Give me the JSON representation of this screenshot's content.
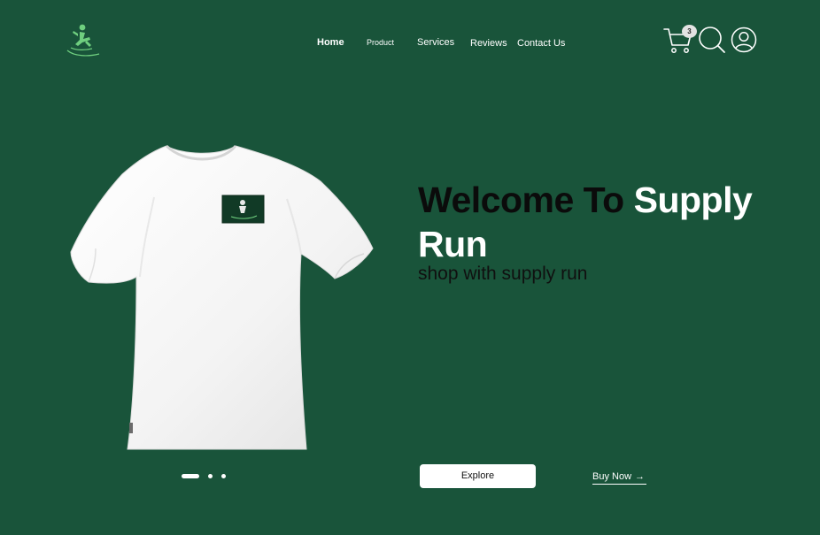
{
  "brand": {
    "logo_icon": "surfer-logo-icon",
    "accent_color": "#6fcf7f"
  },
  "nav": {
    "items": [
      {
        "label": "Home"
      },
      {
        "label": "Product"
      },
      {
        "label": "Services"
      },
      {
        "label": "Reviews"
      },
      {
        "label": "Contact Us"
      }
    ]
  },
  "header_icons": {
    "cart_icon": "cart-icon",
    "cart_count": "3",
    "search_icon": "search-icon",
    "user_icon": "user-icon"
  },
  "hero": {
    "title_dark": "Welcome To",
    "title_light_1": "Supply",
    "title_light_2": "Run",
    "subtitle": "shop with supply run",
    "image": "white-tshirt-image"
  },
  "carousel": {
    "slides": 3,
    "active_index": 0
  },
  "actions": {
    "explore_label": "Explore",
    "buy_now_label": "Buy Now",
    "buy_now_icon": "arrow-right-icon"
  },
  "colors": {
    "background": "#19543a",
    "title_dark": "#0b0b0b",
    "title_light": "#ffffff"
  }
}
